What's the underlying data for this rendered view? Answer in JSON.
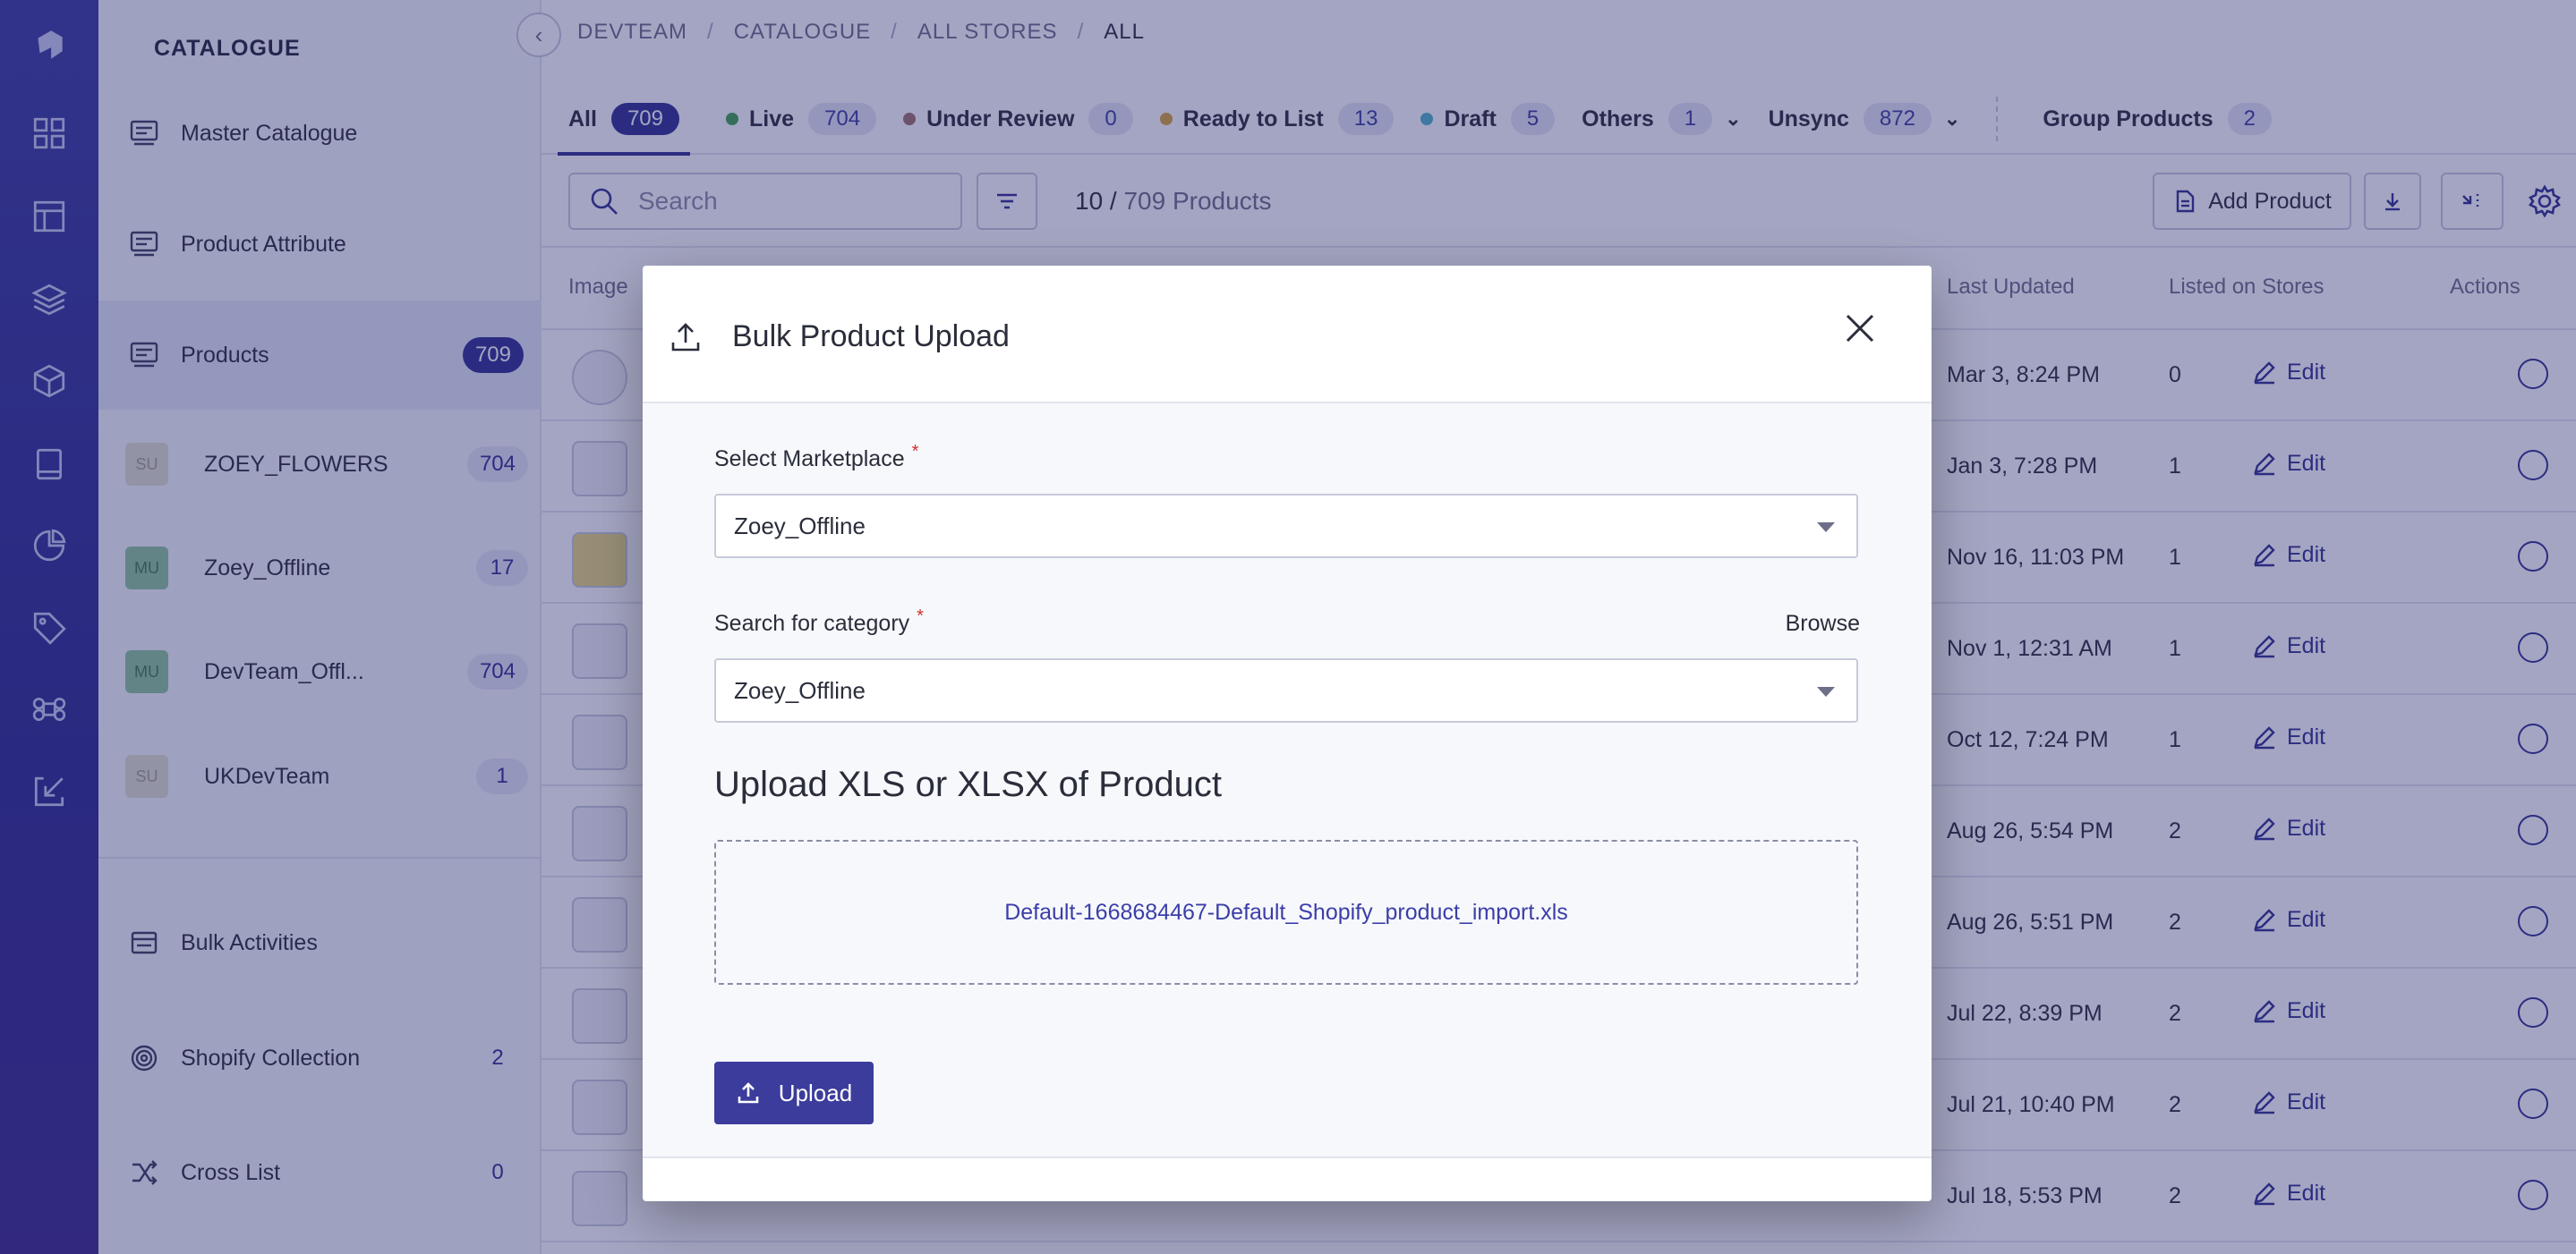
{
  "breadcrumb": [
    "DEVTEAM",
    "CATALOGUE",
    "ALL STORES",
    "ALL"
  ],
  "sidebar": {
    "title": "CATALOGUE",
    "items": [
      {
        "label": "Master Catalogue",
        "icon": "catalogue-icon"
      },
      {
        "label": "Product Attribute",
        "icon": "attribute-icon"
      },
      {
        "label": "Products",
        "icon": "products-icon",
        "count": "709"
      }
    ],
    "stores": [
      {
        "initials": "SU",
        "name": "ZOEY_FLOWERS",
        "count": "704"
      },
      {
        "initials": "MU",
        "name": "Zoey_Offline",
        "count": "17"
      },
      {
        "initials": "MU",
        "name": "DevTeam_Offl...",
        "count": "704"
      },
      {
        "initials": "SU",
        "name": "UKDevTeam",
        "count": "1"
      }
    ],
    "bottom_items": [
      {
        "label": "Bulk Activities",
        "icon": "bulk-icon",
        "count": ""
      },
      {
        "label": "Shopify Collection",
        "icon": "collection-icon",
        "count": "2"
      },
      {
        "label": "Cross List",
        "icon": "shuffle-icon",
        "count": "0"
      }
    ]
  },
  "tabs": [
    {
      "label": "All",
      "count": "709",
      "dot": ""
    },
    {
      "label": "Live",
      "count": "704",
      "dot": "#3fa34d"
    },
    {
      "label": "Under Review",
      "count": "0",
      "dot": "#a0706a"
    },
    {
      "label": "Ready to List",
      "count": "13",
      "dot": "#d9a43a"
    },
    {
      "label": "Draft",
      "count": "5",
      "dot": "#4fb3c9"
    },
    {
      "label": "Others",
      "count": "1",
      "dot": ""
    },
    {
      "label": "Unsync",
      "count": "872",
      "dot": ""
    },
    {
      "label": "Group Products",
      "count": "2",
      "dot": ""
    }
  ],
  "toolbar": {
    "search_placeholder": "Search",
    "count_shown": "10 /",
    "count_total": "709 Products",
    "add_product": "Add Product"
  },
  "table": {
    "headers": {
      "image": "Image",
      "last_updated": "Last Updated",
      "listed": "Listed on Stores",
      "actions": "Actions"
    },
    "edit_label": "Edit",
    "rows": [
      {
        "updated": "Mar 3, 8:24 PM",
        "listed": "0"
      },
      {
        "updated": "Jan 3, 7:28 PM",
        "listed": "1"
      },
      {
        "updated": "Nov 16, 11:03 PM",
        "listed": "1"
      },
      {
        "updated": "Nov 1, 12:31 AM",
        "listed": "1"
      },
      {
        "updated": "Oct 12, 7:24 PM",
        "listed": "1"
      },
      {
        "updated": "Aug 26, 5:54 PM",
        "listed": "2"
      },
      {
        "updated": "Aug 26, 5:51 PM",
        "listed": "2"
      },
      {
        "updated": "Jul 22, 8:39 PM",
        "listed": "2"
      },
      {
        "updated": "Jul 21, 10:40 PM",
        "listed": "2"
      },
      {
        "updated": "Jul 18, 5:53 PM",
        "listed": "2"
      }
    ]
  },
  "modal": {
    "title": "Bulk Product Upload",
    "marketplace_label": "Select Marketplace",
    "marketplace_value": "Zoey_Offline",
    "category_label": "Search for category",
    "category_value": "Zoey_Offline",
    "browse": "Browse",
    "required_mark": "*",
    "upload_title": "Upload XLS or XLSX of Product",
    "file_name": "Default-1668684467-Default_Shopify_product_import.xls",
    "upload_button": "Upload"
  }
}
